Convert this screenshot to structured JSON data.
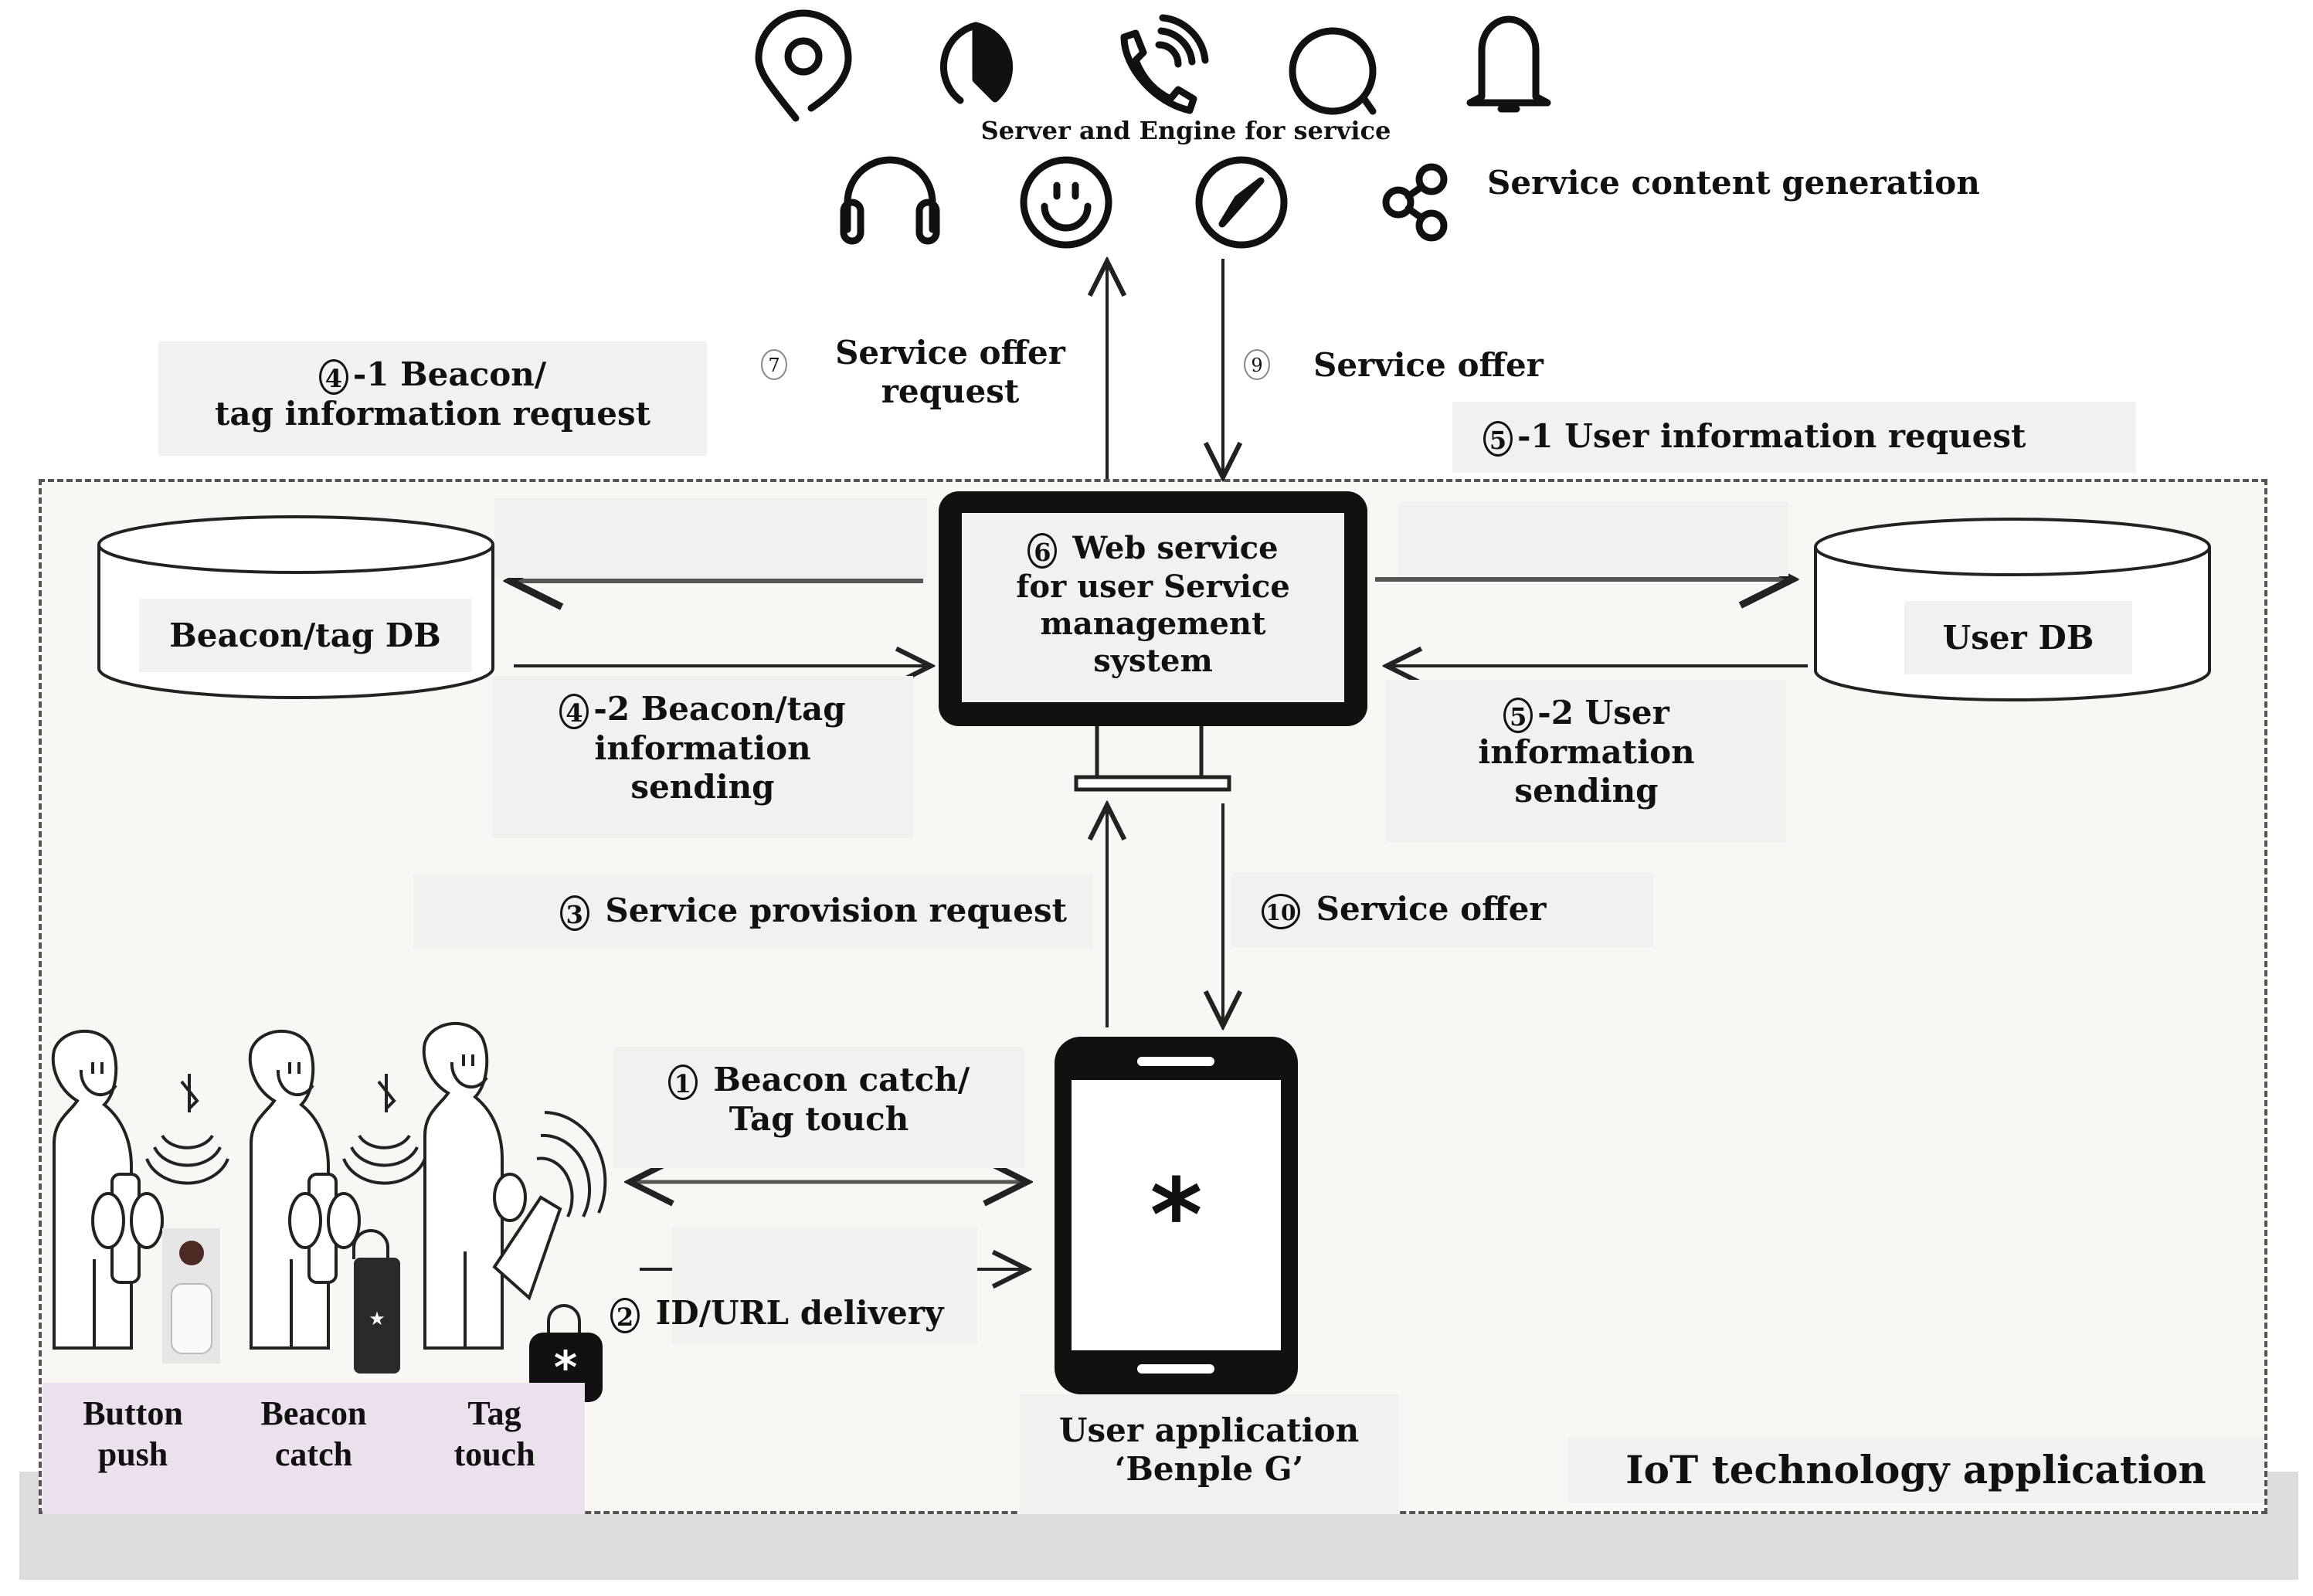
{
  "server": {
    "title": "Server and Engine for service",
    "content_label": "Service content generation",
    "icons_row1": [
      "location-pin-icon",
      "pie-chart-icon",
      "phone-call-icon",
      "chat-bubble-icon",
      "bell-icon"
    ],
    "icons_row2": [
      "headphones-icon",
      "smiley-icon",
      "compass-icon",
      "share-icon"
    ]
  },
  "steps": {
    "s7": {
      "num": "7",
      "text_line1": "Service offer",
      "text_line2": "request"
    },
    "s9": {
      "num": "9",
      "text": "Service offer"
    },
    "s4_1": {
      "num": "4",
      "suffix": "-1 Beacon/",
      "line2": "tag information request"
    },
    "s5_1": {
      "num": "5",
      "suffix": "-1 User information request"
    },
    "s4_2": {
      "num": "4",
      "suffix": "-2 Beacon/tag",
      "line2": "information",
      "line3": "sending"
    },
    "s5_2": {
      "num": "5",
      "suffix": "-2 User",
      "line2": "information",
      "line3": "sending"
    },
    "s6": {
      "num": "6",
      "suffix": " Web service",
      "line2": "for user Service",
      "line3": "management",
      "line4": "system"
    },
    "s3": {
      "num": "3",
      "suffix": " Service provision request"
    },
    "s10": {
      "num": "10",
      "suffix": " Service offer"
    },
    "s1": {
      "num": "1",
      "suffix": " Beacon catch/",
      "line2": "Tag touch"
    },
    "s2": {
      "num": "2",
      "suffix": " ID/URL delivery"
    }
  },
  "databases": {
    "beacon_db": "Beacon/tag DB",
    "user_db": "User DB"
  },
  "app": {
    "line1": "User application",
    "line2": "‘Benple G’",
    "screen_symbol": "*"
  },
  "actions": [
    {
      "line1": "Button",
      "line2": "push"
    },
    {
      "line1": "Beacon",
      "line2": "catch"
    },
    {
      "line1": "Tag",
      "line2": "touch"
    }
  ],
  "container_label": "IoT technology application",
  "colors": {
    "container_bg": "#f9f7f4",
    "label_bg": "#f1f1f1",
    "action_bg": "#ebe1ec",
    "bottom_band": "#dcdcdc"
  }
}
